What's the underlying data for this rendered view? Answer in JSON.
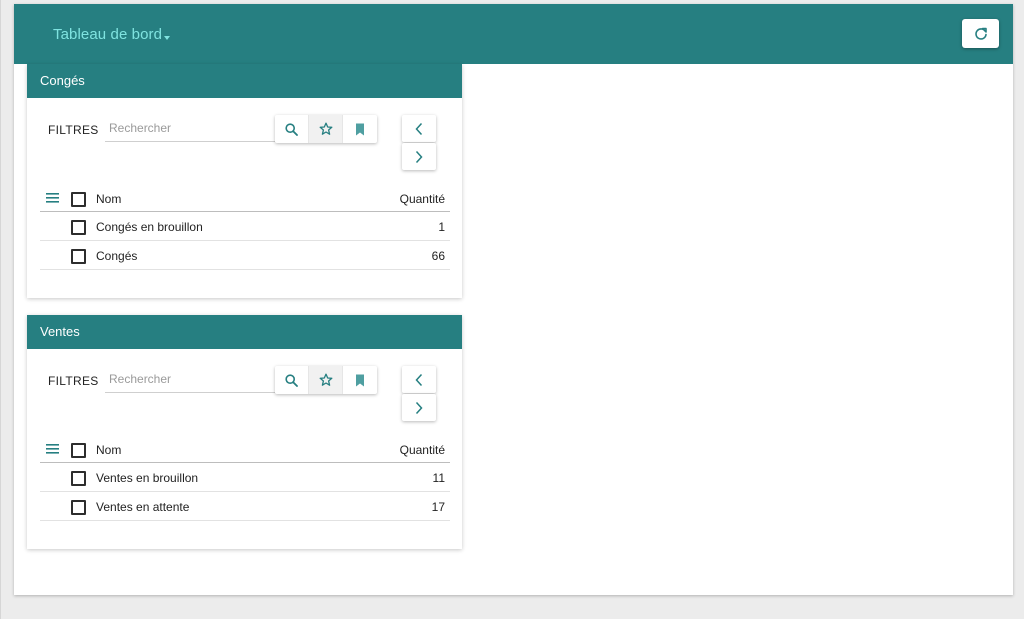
{
  "header": {
    "title": "Tableau de bord",
    "refresh_icon": "refresh-icon"
  },
  "colors": {
    "primary": "#267f81",
    "title_text": "#7fe3e0",
    "background": "#ececec"
  },
  "widgets": [
    {
      "title": "Congés",
      "filters_label": "FILTRES",
      "search_placeholder": "Rechercher",
      "tools": [
        "search-icon",
        "star-icon",
        "bookmark-icon"
      ],
      "columns": [
        "Nom",
        "Quantité"
      ],
      "rows": [
        {
          "name": "Congés en brouillon",
          "qty": "1"
        },
        {
          "name": "Congés",
          "qty": "66"
        }
      ]
    },
    {
      "title": "Ventes",
      "filters_label": "FILTRES",
      "search_placeholder": "Rechercher",
      "tools": [
        "search-icon",
        "star-icon",
        "bookmark-icon"
      ],
      "columns": [
        "Nom",
        "Quantité"
      ],
      "rows": [
        {
          "name": "Ventes en brouillon",
          "qty": "11"
        },
        {
          "name": "Ventes en attente",
          "qty": "17"
        }
      ]
    }
  ]
}
